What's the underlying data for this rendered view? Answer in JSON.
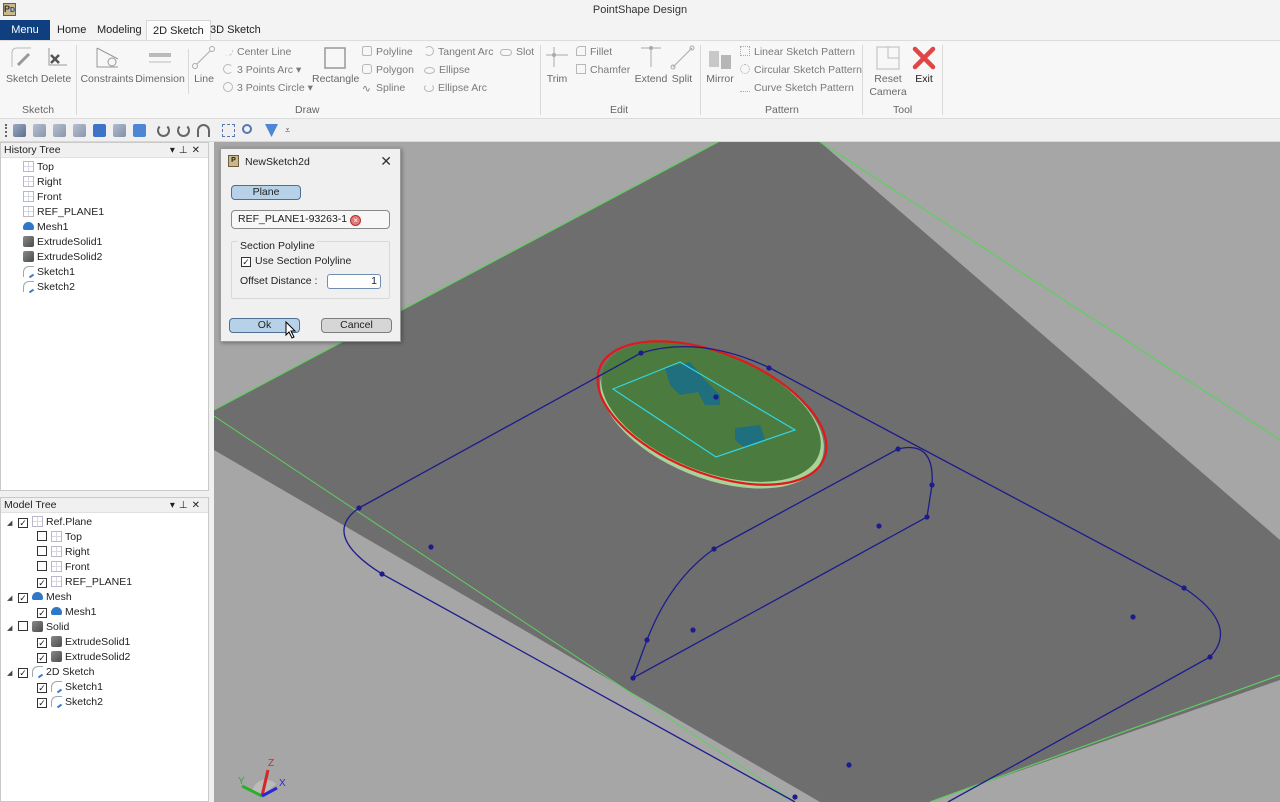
{
  "app": {
    "title": "PointShape Design",
    "logo": "PD"
  },
  "tabs": [
    {
      "label": "Menu"
    },
    {
      "label": "Home"
    },
    {
      "label": "Modeling"
    },
    {
      "label": "2D Sketch",
      "active": true
    },
    {
      "label": "3D Sketch"
    }
  ],
  "ribbon": {
    "groups": {
      "sketch": {
        "label": "Sketch",
        "items": [
          "Sketch",
          "Delete"
        ]
      },
      "draw": {
        "label": "Draw",
        "constraints": "Constraints",
        "dimension": "Dimension",
        "line": "Line",
        "center_line": "Center Line",
        "three_points_arc": "3 Points Arc",
        "three_points_circle": "3 Points Circle",
        "rectangle": "Rectangle",
        "polyline": "Polyline",
        "polygon": "Polygon",
        "spline": "Spline",
        "tangent_arc": "Tangent Arc",
        "ellipse": "Ellipse",
        "ellipse_arc": "Ellipse Arc",
        "slot": "Slot"
      },
      "edit": {
        "label": "Edit",
        "trim": "Trim",
        "fillet": "Fillet",
        "chamfer": "Chamfer",
        "extend": "Extend",
        "split": "Split"
      },
      "pattern": {
        "label": "Pattern",
        "mirror": "Mirror",
        "linear": "Linear Sketch Pattern",
        "circular": "Circular Sketch Pattern",
        "curve": "Curve Sketch Pattern"
      },
      "tool": {
        "label": "Tool",
        "reset_camera_1": "Reset",
        "reset_camera_2": "Camera",
        "exit": "Exit"
      }
    }
  },
  "quick_toolbar": [
    "view-top-icon",
    "view-bottom-icon",
    "view-front-icon",
    "view-back-icon",
    "view-left-icon",
    "view-right-icon",
    "view-iso-icon",
    "rotate-cw-icon",
    "rotate-ccw-icon",
    "rotate-flip-icon",
    "zoom-fit-icon",
    "zoom-window-icon",
    "display-mode-icon"
  ],
  "history_tree": {
    "title": "History Tree",
    "items": [
      {
        "label": "Top",
        "icon": "plane"
      },
      {
        "label": "Right",
        "icon": "plane"
      },
      {
        "label": "Front",
        "icon": "plane"
      },
      {
        "label": "REF_PLANE1",
        "icon": "plane"
      },
      {
        "label": "Mesh1",
        "icon": "mesh"
      },
      {
        "label": "ExtrudeSolid1",
        "icon": "solid"
      },
      {
        "label": "ExtrudeSolid2",
        "icon": "solid"
      },
      {
        "label": "Sketch1",
        "icon": "sketch"
      },
      {
        "label": "Sketch2",
        "icon": "sketch"
      }
    ]
  },
  "model_tree": {
    "title": "Model Tree",
    "items": [
      {
        "label": "Ref.Plane",
        "icon": "plane",
        "level": 0,
        "checked": true
      },
      {
        "label": "Top",
        "icon": "plane",
        "level": 1,
        "checked": false
      },
      {
        "label": "Right",
        "icon": "plane",
        "level": 1,
        "checked": false
      },
      {
        "label": "Front",
        "icon": "plane",
        "level": 1,
        "checked": false
      },
      {
        "label": "REF_PLANE1",
        "icon": "plane",
        "level": 1,
        "checked": true
      },
      {
        "label": "Mesh",
        "icon": "mesh",
        "level": 0,
        "checked": true
      },
      {
        "label": "Mesh1",
        "icon": "mesh",
        "level": 1,
        "checked": true
      },
      {
        "label": "Solid",
        "icon": "solid",
        "level": 0,
        "checked": false
      },
      {
        "label": "ExtrudeSolid1",
        "icon": "solid",
        "level": 1,
        "checked": true
      },
      {
        "label": "ExtrudeSolid2",
        "icon": "solid",
        "level": 1,
        "checked": true
      },
      {
        "label": "2D Sketch",
        "icon": "sketch",
        "level": 0,
        "checked": true
      },
      {
        "label": "Sketch1",
        "icon": "sketch",
        "level": 1,
        "checked": true
      },
      {
        "label": "Sketch2",
        "icon": "sketch",
        "level": 1,
        "checked": true
      }
    ]
  },
  "dialog": {
    "title": "NewSketch2d",
    "plane_button": "Plane",
    "plane_value": "REF_PLANE1-93263-1",
    "section_group": "Section Polyline",
    "use_section_polyline": "Use Section Polyline",
    "use_section_checked": true,
    "offset_label": "Offset Distance :",
    "offset_value": "1",
    "ok": "Ok",
    "cancel": "Cancel"
  },
  "viewport": {
    "axes": {
      "x": "X",
      "y": "Y",
      "z": "Z"
    },
    "colors": {
      "plane": "#6e6e6e",
      "background": "#a6a6a6",
      "sketch": "#1c1c8c",
      "section": "#e01a1a",
      "mesh": "#4a7a3e",
      "plane_edge": "#5fcf5f"
    }
  }
}
